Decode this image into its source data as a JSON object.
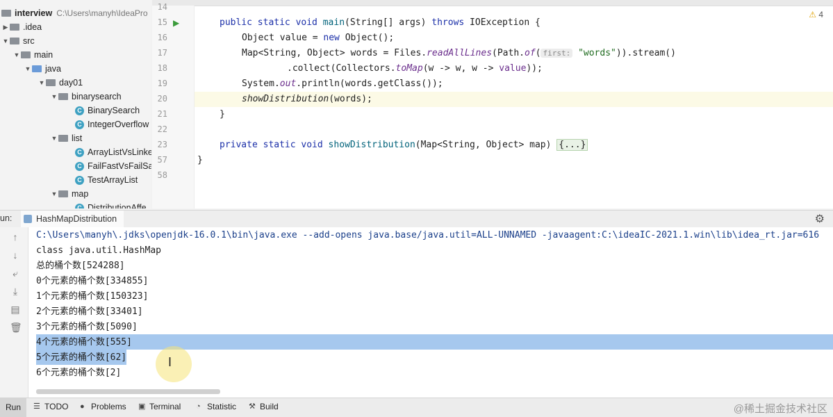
{
  "project": {
    "root_name": "interview",
    "root_path": "C:\\Users\\manyh\\IdeaPro",
    "items": [
      {
        "label": ".idea"
      },
      {
        "label": "src"
      },
      {
        "label": "main"
      },
      {
        "label": "java"
      },
      {
        "label": "day01"
      },
      {
        "label": "binarysearch"
      },
      {
        "label": "BinarySearch"
      },
      {
        "label": "IntegerOverflow"
      },
      {
        "label": "list"
      },
      {
        "label": "ArrayListVsLinke"
      },
      {
        "label": "FailFastVsFailSa"
      },
      {
        "label": "TestArrayList"
      },
      {
        "label": "map"
      },
      {
        "label": "DistributionAffe"
      }
    ]
  },
  "editor": {
    "warning_count": "4",
    "line_numbers": [
      "14",
      "15",
      "16",
      "17",
      "18",
      "19",
      "20",
      "21",
      "22",
      "23",
      "57",
      "58"
    ],
    "lines": {
      "l15_a": "public static void ",
      "l15_b": "main",
      "l15_c": "(String[] args) ",
      "l15_d": "throws",
      "l15_e": " IOException {",
      "l16_a": "Object value = ",
      "l16_b": "new",
      "l16_c": " Object();",
      "l17_a": "Map<String, Object> words = Files.",
      "l17_b": "readAllLines",
      "l17_c": "(Path.",
      "l17_d": "of",
      "l17_e": "(",
      "l17_hint": "first:",
      "l17_f": "\"words\"",
      "l17_g": ")).stream()",
      "l18_a": ".collect(Collectors.",
      "l18_b": "toMap",
      "l18_c": "(w -> w, w -> ",
      "l18_d": "value",
      "l18_e": "));",
      "l19_a": "System.",
      "l19_b": "out",
      "l19_c": ".println(words.getClass());",
      "l20_a": "showDistribution",
      "l20_b": "(words);",
      "l21": "}",
      "l23_a": "private static void ",
      "l23_b": "showDistribution",
      "l23_c": "(Map<String, Object> map) ",
      "l23_fold": "{...}",
      "l57": "}"
    }
  },
  "run": {
    "label": "un:",
    "tab": "HashMapDistribution",
    "output": [
      "C:\\Users\\manyh\\.jdks\\openjdk-16.0.1\\bin\\java.exe --add-opens java.base/java.util=ALL-UNNAMED -javaagent:C:\\ideaIC-2021.1.win\\lib\\idea_rt.jar=616",
      "class java.util.HashMap",
      "总的桶个数[524288]",
      "0个元素的桶个数[334855]",
      "1个元素的桶个数[150323]",
      "2个元素的桶个数[33401]",
      "3个元素的桶个数[5090]",
      "4个元素的桶个数[555]",
      "5个元素的桶个数[62]",
      "6个元素的桶个数[2]"
    ]
  },
  "bottom_bar": {
    "run": "Run",
    "todo": "TODO",
    "problems": "Problems",
    "terminal": "Terminal",
    "statistic": "Statistic",
    "build": "Build",
    "watermark": "@稀土掘金技术社区"
  }
}
